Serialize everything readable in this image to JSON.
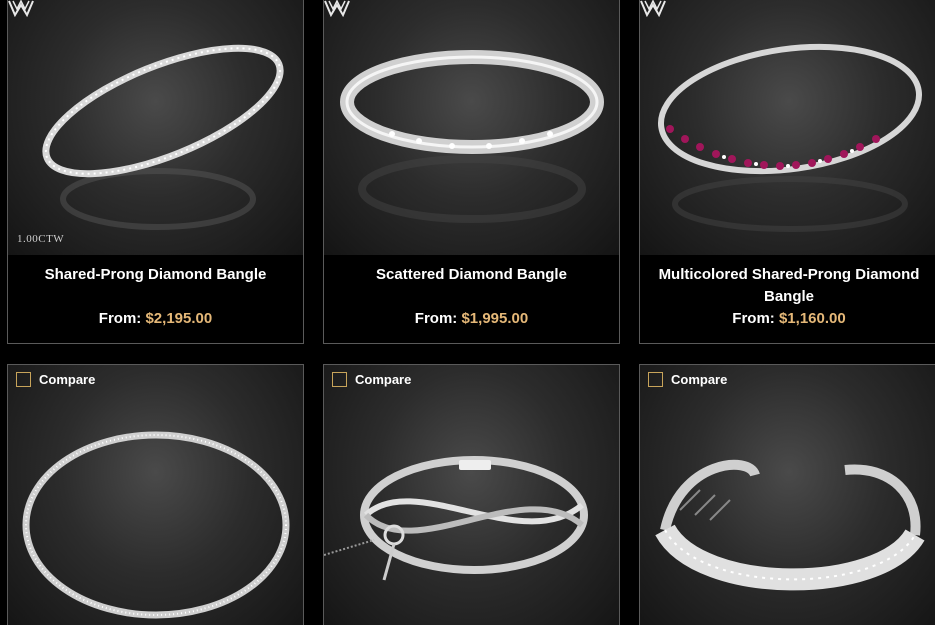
{
  "products": [
    {
      "name": "Shared-Prong Diamond Bangle",
      "price_prefix": "From:",
      "price": "$2,195.00",
      "badge": "1.00CTW",
      "logo_icon": "whiteflash-logo-icon"
    },
    {
      "name": "Scattered Diamond Bangle",
      "price_prefix": "From:",
      "price": "$1,995.00",
      "logo_icon": "whiteflash-logo-icon"
    },
    {
      "name": "Multicolored Shared-Prong Diamond Bangle",
      "price_prefix": "From:",
      "price": "$1,160.00",
      "logo_icon": "whiteflash-logo-icon"
    }
  ],
  "compare_label": "Compare",
  "colors": {
    "background": "#000000",
    "card_border": "#5a5a5a",
    "price_accent": "#e5b878",
    "checkbox_border": "#c8a45a"
  }
}
